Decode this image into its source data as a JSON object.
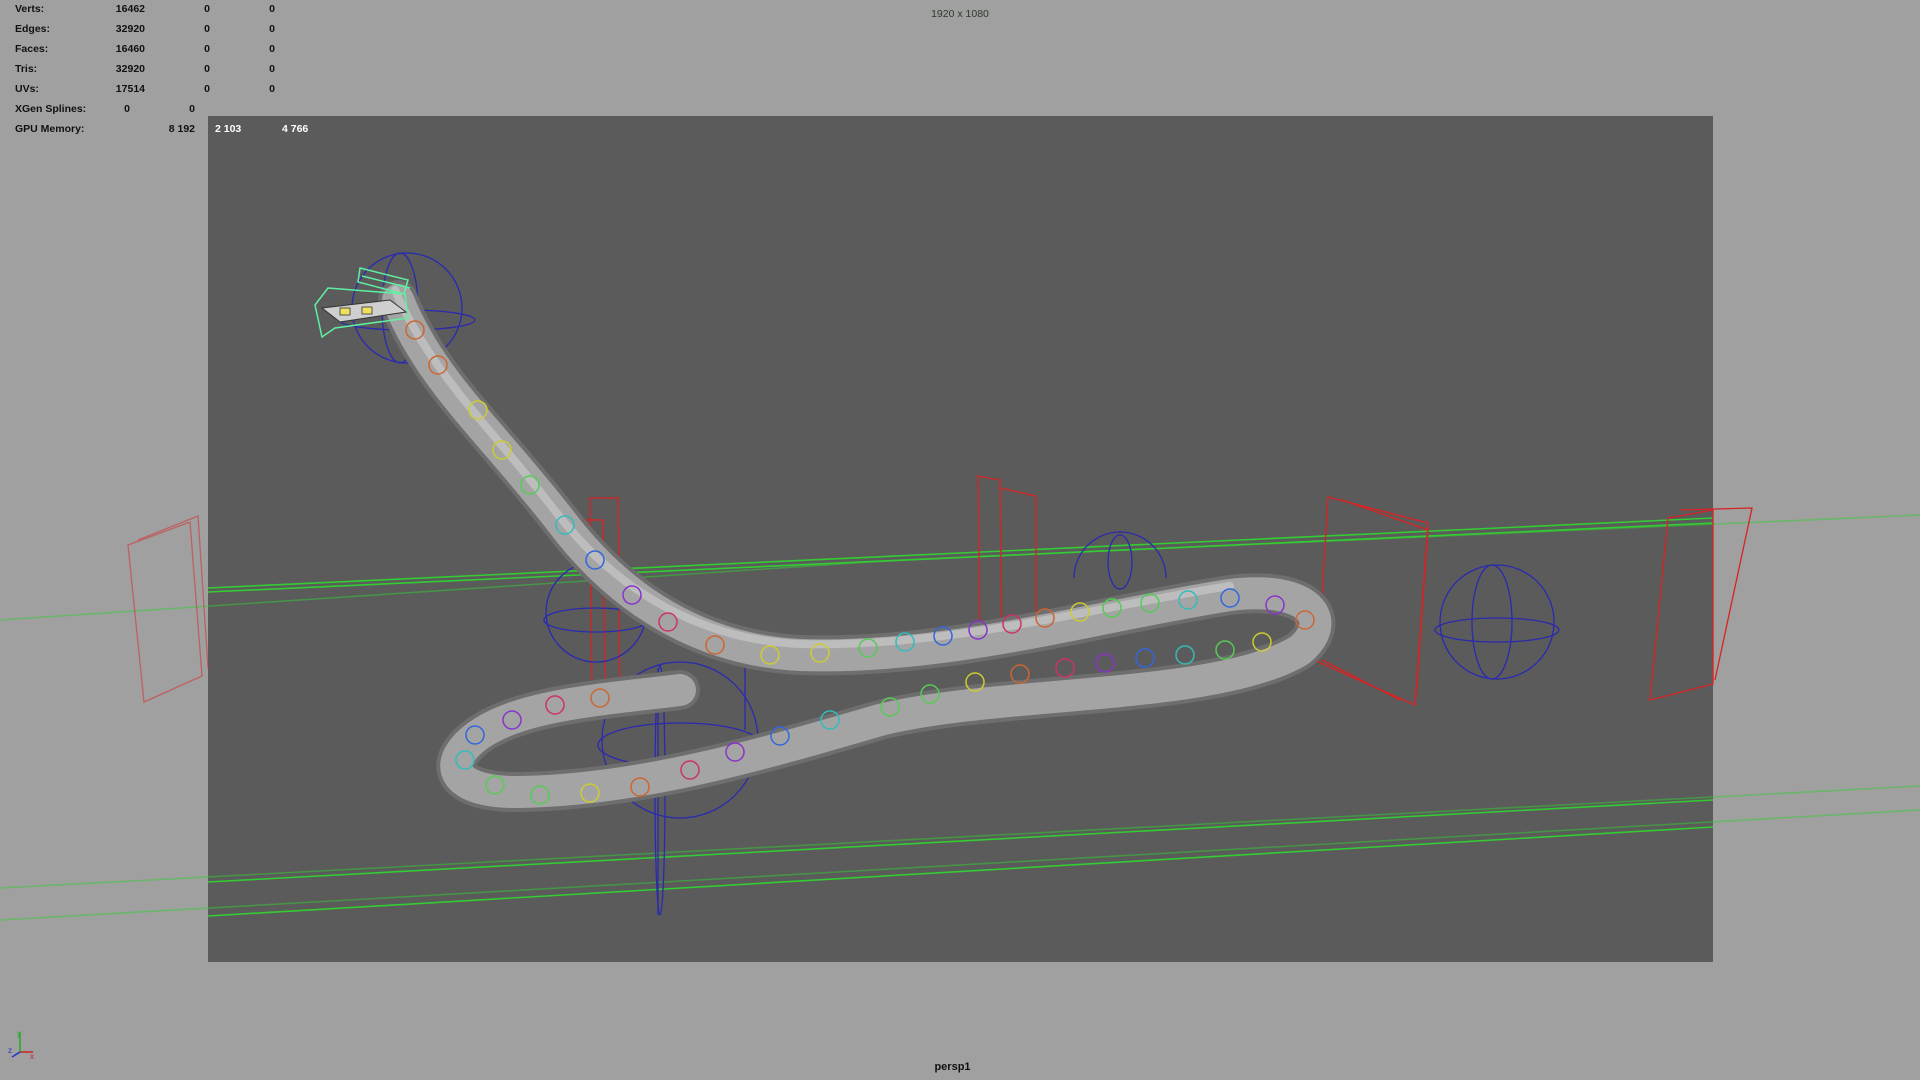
{
  "hud": {
    "rows": [
      {
        "label": "Verts:",
        "v1": "16462",
        "v2": "0",
        "v3": "0"
      },
      {
        "label": "Edges:",
        "v1": "32920",
        "v2": "0",
        "v3": "0"
      },
      {
        "label": "Faces:",
        "v1": "16460",
        "v2": "0",
        "v3": "0"
      },
      {
        "label": "Tris:",
        "v1": "32920",
        "v2": "0",
        "v3": "0"
      },
      {
        "label": "UVs:",
        "v1": "17514",
        "v2": "0",
        "v3": "0"
      },
      {
        "label": "XGen Splines:",
        "v1": "0",
        "v2": "0"
      },
      {
        "label": "GPU Memory:",
        "v1": "8 192",
        "v2": "2 103",
        "v3": "4 766"
      }
    ]
  },
  "viewport": {
    "resolution_label": "1920 x 1080",
    "camera_name": "persp1",
    "background_color": "#a0a0a0",
    "gate_color": "#5b5b5b"
  },
  "scene": {
    "object": "snake-rig",
    "colors": {
      "mesh": "#9e9e9e",
      "curve": "#33cc33",
      "cage": "#d92222",
      "sphere_control": "#2a2ab0",
      "head_control": "#5ef0a0"
    }
  },
  "axis_indicator": {
    "x_label": "x",
    "y_label": "y",
    "z_label": "z"
  }
}
